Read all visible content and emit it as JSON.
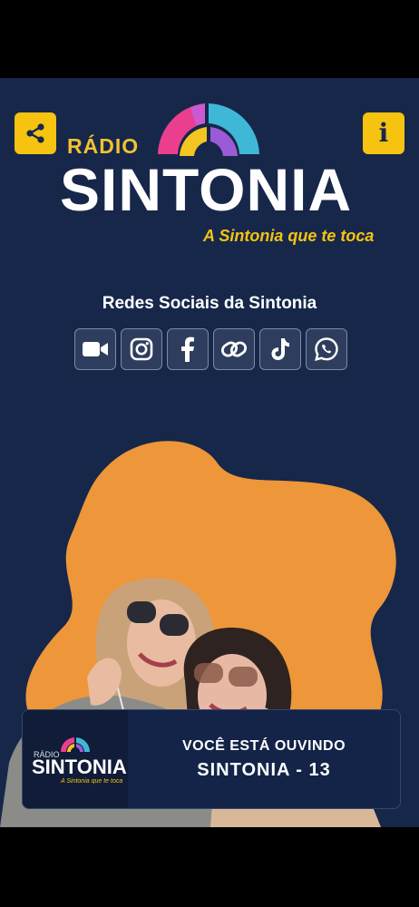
{
  "header": {
    "share_icon": "share-icon",
    "info_label": "i"
  },
  "logo": {
    "radio_word": "RÁDIO",
    "brand_word": "SINTONIA",
    "tagline": "A Sintonia que te toca"
  },
  "social": {
    "title": "Redes Sociais da Sintonia",
    "items": [
      {
        "icon": "video-camera-icon"
      },
      {
        "icon": "instagram-icon"
      },
      {
        "icon": "facebook-icon"
      },
      {
        "icon": "link-icon"
      },
      {
        "icon": "tiktok-icon"
      },
      {
        "icon": "whatsapp-icon"
      }
    ]
  },
  "player": {
    "mini_radio": "RÁDIO",
    "mini_brand": "SINTONIA",
    "mini_tagline": "A Sintonia que te toca",
    "status_line": "VOCÊ ESTÁ OUVINDO",
    "station_line": "SINTONIA - 13"
  },
  "colors": {
    "background": "#16274a",
    "accent_yellow": "#f5c310",
    "blob_orange": "#ee963a"
  }
}
